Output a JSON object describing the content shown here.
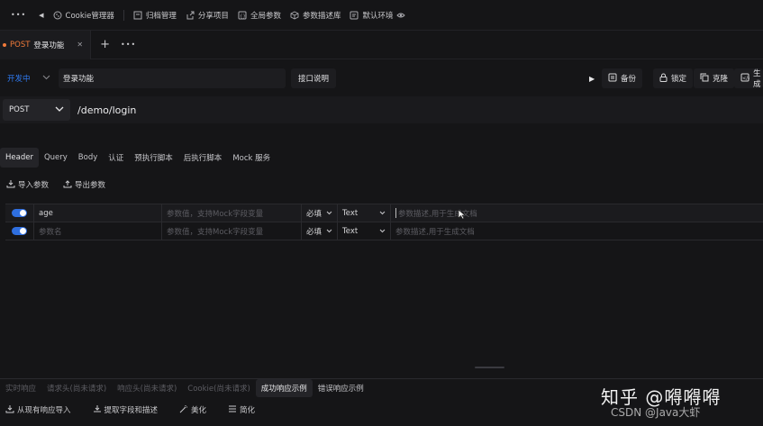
{
  "toolbar": {
    "more": "•••",
    "back": "◀",
    "items": [
      {
        "icon": "cookie-icon",
        "label": "Cookie管理器"
      },
      {
        "icon": "archive-icon",
        "label": "归档管理"
      },
      {
        "icon": "share-icon",
        "label": "分享项目"
      },
      {
        "icon": "global-param-icon",
        "label": "全局参数"
      },
      {
        "icon": "cube-icon",
        "label": "参数描述库"
      },
      {
        "icon": "environment-icon",
        "label": "默认环境"
      }
    ]
  },
  "tabs": {
    "open": [
      {
        "method": "POST",
        "title": "登录功能"
      }
    ],
    "close": "✕",
    "add": "+",
    "more": "•••"
  },
  "env": {
    "status": "开发中",
    "name": "登录功能",
    "desc_button": "接口说明",
    "actions": {
      "run": "▶",
      "backup": "备份",
      "lock": "锁定",
      "clone": "克隆",
      "generate": "生成"
    }
  },
  "request": {
    "method": "POST",
    "url": "/demo/login"
  },
  "param_tabs": [
    "Header",
    "Query",
    "Body",
    "认证",
    "预执行脚本",
    "后执行脚本",
    "Mock 服务"
  ],
  "param_actions": {
    "import": "导入参数",
    "export": "导出参数"
  },
  "params": {
    "rows": [
      {
        "enabled": true,
        "name": "age",
        "name_placeholder": "参数名",
        "value_placeholder": "参数值，支持Mock字段变量",
        "required": "必填",
        "type": "Text",
        "desc_placeholder": "参数描述,用于生成文档"
      },
      {
        "enabled": true,
        "name": "",
        "name_placeholder": "参数名",
        "value_placeholder": "参数值，支持Mock字段变量",
        "required": "必填",
        "type": "Text",
        "desc_placeholder": "参数描述,用于生成文档"
      }
    ]
  },
  "response_tabs": [
    "实时响应",
    "请求头(尚未请求)",
    "响应头(尚未请求)",
    "Cookie(尚未请求)",
    "成功响应示例",
    "错误响应示例"
  ],
  "response_actions": [
    "从现有响应导入",
    "提取字段和描述",
    "美化",
    "简化"
  ],
  "watermark": {
    "main": "知乎 @嘚嘚嘚",
    "sub": "CSDN @Java大虾"
  },
  "colors": {
    "accent": "#2f7cf6",
    "post": "#f07a3a"
  }
}
